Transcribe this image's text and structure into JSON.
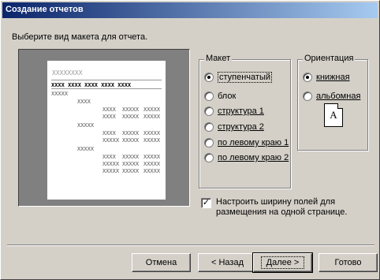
{
  "window": {
    "title": "Создание отчетов"
  },
  "prompt": "Выберите вид макета для отчета.",
  "preview": {
    "title": "XXXXXXXX",
    "header_row": "XXXX XXXX XXXX XXXX XXXX",
    "cell_a": "XXXX",
    "cell_b": "XXXX",
    "cell_c": "XXXX",
    "cell_d": "XXXXX",
    "cell_e": "XXXXX",
    "cell_f": "XXXX"
  },
  "layout_group": {
    "label": "Макет",
    "options": [
      {
        "label": "ступенчатый",
        "selected": true
      },
      {
        "label": "блок",
        "selected": false
      },
      {
        "label": "структура 1",
        "selected": false
      },
      {
        "label": "структура 2",
        "selected": false
      },
      {
        "label": "по левому краю 1",
        "selected": false
      },
      {
        "label": "по левому краю 2",
        "selected": false
      }
    ]
  },
  "orientation_group": {
    "label": "Ориентация",
    "options": [
      {
        "label": "книжная",
        "selected": true
      },
      {
        "label": "альбомная",
        "selected": false
      }
    ],
    "icon_glyph": "A"
  },
  "fit_checkbox": {
    "checked": true,
    "label": "Настроить ширину полей для размещения на одной странице."
  },
  "buttons": {
    "cancel": "Отмена",
    "back": "< Назад",
    "next": "Далее >",
    "finish": "Готово"
  }
}
